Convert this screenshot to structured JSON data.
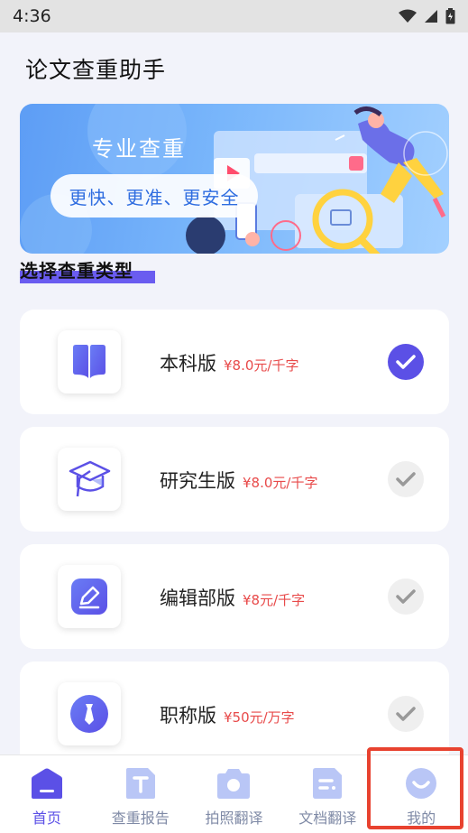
{
  "status_bar": {
    "time": "4:36",
    "icons": [
      "wifi-icon",
      "signal-icon",
      "battery-icon"
    ]
  },
  "app": {
    "title": "论文查重助手"
  },
  "banner": {
    "title": "专业查重",
    "subtitle": "更快、更准、更安全"
  },
  "section": {
    "title": "选择查重类型"
  },
  "options": [
    {
      "name": "本科版",
      "price": "¥8.0元/千字",
      "icon": "book-icon",
      "selected": true
    },
    {
      "name": "研究生版",
      "price": "¥8.0元/千字",
      "icon": "graduation-cap-icon",
      "selected": false
    },
    {
      "name": "编辑部版",
      "price": "¥8元/千字",
      "icon": "edit-icon",
      "selected": false
    },
    {
      "name": "职称版",
      "price": "¥50元/万字",
      "icon": "tie-badge-icon",
      "selected": false
    }
  ],
  "tabs": [
    {
      "label": "首页",
      "icon": "home-icon",
      "active": true
    },
    {
      "label": "查重报告",
      "icon": "report-icon",
      "active": false
    },
    {
      "label": "拍照翻译",
      "icon": "camera-icon",
      "active": false
    },
    {
      "label": "文档翻译",
      "icon": "document-icon",
      "active": false
    },
    {
      "label": "我的",
      "icon": "profile-smile-icon",
      "active": false
    }
  ],
  "colors": {
    "accent": "#5b50e6",
    "price": "#e84a4a",
    "highlight": "#e8422f",
    "background": "#f2f3fa"
  }
}
